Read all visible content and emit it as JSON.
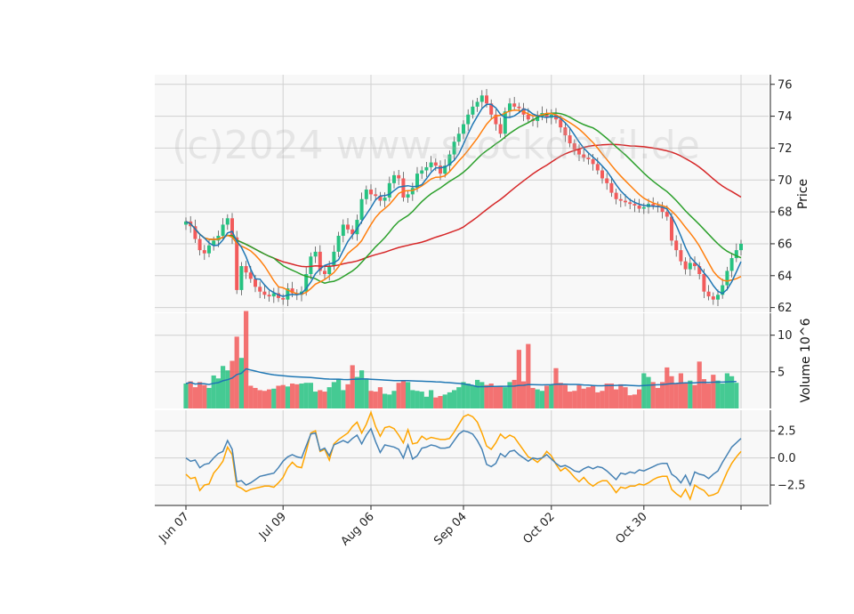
{
  "watermark": "(c)2024 www.stockdevil.de",
  "chart_data": {
    "type": "candlestick",
    "panels": {
      "price": {
        "ylabel": "Price",
        "ylim": [
          61.7,
          76.6
        ],
        "yticks": [
          62,
          64,
          66,
          68,
          70,
          72,
          74,
          76
        ],
        "grid": true
      },
      "volume": {
        "ylabel": "Volume  10^6",
        "ylim": [
          0,
          13
        ],
        "yticks": [
          5,
          10
        ],
        "grid": true
      },
      "oscillator": {
        "ylim": [
          -4.3,
          4.4
        ],
        "yticks": [
          -2.5,
          0.0,
          2.5
        ],
        "ytick_labels": [
          "−2.5",
          "0.0",
          "2.5"
        ],
        "grid": true
      }
    },
    "x_tick_labels": [
      {
        "label": "Jun 07",
        "index": 0
      },
      {
        "label": "Jul 09",
        "index": 21
      },
      {
        "label": "Aug 06",
        "index": 40
      },
      {
        "label": "Sep 04",
        "index": 60
      },
      {
        "label": "Oct 02",
        "index": 79
      },
      {
        "label": "Oct 30",
        "index": 99
      },
      {
        "label": "",
        "index": 120
      }
    ],
    "colors": {
      "up": "#26c281",
      "down": "#f25b5b",
      "ma_blue": "#1f77b4",
      "ma_orange": "#ff7f0e",
      "ma_green": "#2ca02c",
      "ma_red": "#d62728",
      "vol_avg": "#1f77b4",
      "osc_blue": "#4682b4",
      "osc_orange": "#ffa500"
    },
    "closes": [
      67.4,
      67.1,
      66.3,
      65.6,
      65.4,
      65.9,
      66.2,
      66.5,
      67.2,
      67.6,
      66.4,
      63.1,
      64.6,
      64.2,
      63.8,
      63.3,
      63.0,
      62.8,
      62.7,
      62.9,
      62.6,
      62.5,
      63.2,
      62.9,
      62.8,
      63.0,
      64.1,
      65.2,
      65.5,
      64.3,
      64.1,
      64.6,
      65.5,
      66.5,
      67.2,
      66.9,
      66.6,
      67.5,
      68.8,
      69.4,
      69.1,
      69.0,
      68.7,
      68.9,
      69.8,
      70.3,
      70.1,
      68.9,
      69.1,
      69.5,
      70.4,
      70.6,
      70.8,
      71.1,
      70.9,
      70.4,
      70.9,
      71.6,
      72.4,
      72.9,
      73.5,
      74.1,
      74.6,
      74.9,
      75.3,
      74.8,
      74.1,
      73.5,
      72.9,
      74.3,
      74.8,
      74.6,
      74.5,
      74.1,
      73.8,
      73.7,
      74.0,
      74.2,
      73.9,
      74.1,
      73.8,
      73.3,
      72.8,
      72.3,
      71.9,
      71.6,
      71.4,
      71.3,
      71.0,
      70.6,
      70.1,
      69.8,
      69.2,
      68.8,
      68.7,
      68.6,
      68.5,
      68.4,
      68.2,
      68.3,
      68.5,
      68.4,
      68.3,
      68.0,
      67.7,
      66.2,
      65.6,
      64.9,
      64.4,
      64.8,
      64.6,
      64.1,
      63.0,
      62.7,
      62.5,
      62.8,
      63.4,
      64.3,
      65.1,
      65.6,
      66.0
    ],
    "volumes": [
      3.4,
      3.7,
      2.9,
      3.6,
      3.2,
      2.8,
      4.5,
      4.1,
      5.8,
      5.2,
      6.5,
      9.8,
      6.9,
      13.3,
      3.1,
      2.8,
      2.5,
      2.4,
      2.6,
      2.7,
      3.1,
      3.2,
      3.0,
      3.4,
      3.3,
      3.4,
      3.5,
      3.5,
      2.3,
      2.5,
      2.3,
      2.9,
      3.6,
      4.0,
      2.5,
      3.3,
      5.9,
      4.3,
      5.2,
      4.1,
      2.4,
      2.3,
      2.9,
      2.0,
      1.9,
      2.4,
      3.5,
      3.8,
      3.6,
      2.5,
      2.4,
      2.3,
      1.6,
      2.5,
      1.5,
      1.7,
      1.9,
      2.2,
      2.5,
      2.9,
      3.6,
      3.4,
      3.1,
      3.9,
      3.6,
      3.2,
      3.4,
      3.0,
      3.1,
      2.9,
      3.6,
      3.9,
      8.0,
      3.7,
      8.8,
      2.8,
      2.6,
      2.4,
      3.1,
      3.2,
      5.5,
      3.5,
      3.2,
      2.3,
      2.4,
      3.2,
      2.7,
      2.9,
      3.1,
      2.2,
      2.4,
      3.4,
      3.4,
      2.6,
      3.3,
      2.9,
      1.8,
      1.9,
      2.6,
      4.8,
      4.3,
      3.6,
      2.8,
      3.6,
      5.6,
      4.4,
      3.4,
      4.8,
      3.5,
      3.8,
      3.2,
      6.4,
      4.0,
      3.4,
      4.6,
      3.8,
      3.4,
      4.8,
      4.4,
      3.5
    ],
    "osc_blue": [
      0.0,
      -0.3,
      -0.2,
      -0.9,
      -0.6,
      -0.5,
      0.0,
      0.4,
      0.6,
      1.6,
      0.8,
      -2.2,
      -2.1,
      -2.5,
      -2.3,
      -2.0,
      -1.7,
      -1.6,
      -1.5,
      -1.4,
      -0.9,
      -0.3,
      0.1,
      0.3,
      0.1,
      0.0,
      1.1,
      2.2,
      2.3,
      0.7,
      0.9,
      0.2,
      1.2,
      1.4,
      1.6,
      1.4,
      1.8,
      2.1,
      1.3,
      2.1,
      2.7,
      1.5,
      0.5,
      1.2,
      1.1,
      1.0,
      0.8,
      0.0,
      1.2,
      -0.1,
      0.2,
      0.9,
      1.0,
      1.2,
      1.1,
      0.9,
      0.9,
      1.0,
      1.6,
      2.2,
      2.5,
      2.4,
      2.2,
      1.6,
      0.8,
      -0.6,
      -0.8,
      -0.5,
      0.4,
      0.1,
      0.6,
      0.7,
      0.3,
      0.0,
      -0.3,
      0.0,
      -0.1,
      0.0,
      0.3,
      -0.1,
      -0.5,
      -0.8,
      -0.7,
      -0.9,
      -1.2,
      -1.3,
      -1.0,
      -0.8,
      -1.0,
      -0.8,
      -0.9,
      -1.2,
      -1.6,
      -2.0,
      -1.4,
      -1.5,
      -1.3,
      -1.4,
      -1.1,
      -1.2,
      -1.0,
      -0.8,
      -0.6,
      -0.5,
      -0.5,
      -1.5,
      -1.8,
      -2.3,
      -1.6,
      -2.5,
      -1.3,
      -1.5,
      -1.6,
      -1.9,
      -1.5,
      -1.2,
      -0.4,
      0.3,
      1.0,
      1.4,
      1.8
    ],
    "osc_orange": [
      -1.5,
      -1.9,
      -1.8,
      -3.0,
      -2.5,
      -2.4,
      -1.4,
      -0.9,
      -0.3,
      1.0,
      0.3,
      -2.6,
      -2.8,
      -3.1,
      -2.9,
      -2.8,
      -2.7,
      -2.6,
      -2.6,
      -2.7,
      -2.3,
      -1.8,
      -0.9,
      -0.4,
      -0.8,
      -0.9,
      0.6,
      2.3,
      2.5,
      0.6,
      0.8,
      -0.2,
      1.3,
      1.7,
      2.0,
      2.3,
      2.9,
      3.3,
      2.3,
      3.1,
      4.2,
      2.9,
      2.0,
      2.8,
      2.9,
      2.7,
      2.1,
      1.4,
      2.6,
      1.3,
      1.4,
      2.0,
      1.7,
      1.9,
      1.8,
      1.7,
      1.7,
      1.8,
      2.4,
      3.1,
      3.8,
      4.0,
      3.8,
      3.3,
      2.3,
      1.1,
      0.8,
      1.4,
      2.2,
      1.8,
      2.1,
      1.9,
      1.3,
      0.7,
      0.1,
      -0.1,
      -0.4,
      0.0,
      0.6,
      0.2,
      -0.6,
      -1.2,
      -0.9,
      -1.3,
      -1.8,
      -2.2,
      -1.8,
      -2.3,
      -2.6,
      -2.3,
      -2.1,
      -2.1,
      -2.6,
      -3.2,
      -2.7,
      -2.8,
      -2.6,
      -2.6,
      -2.4,
      -2.5,
      -2.3,
      -2.0,
      -1.8,
      -1.7,
      -1.7,
      -2.9,
      -3.3,
      -3.6,
      -2.9,
      -3.8,
      -2.5,
      -2.8,
      -3.0,
      -3.5,
      -3.4,
      -3.2,
      -2.3,
      -1.3,
      -0.5,
      0.1,
      0.6
    ]
  }
}
